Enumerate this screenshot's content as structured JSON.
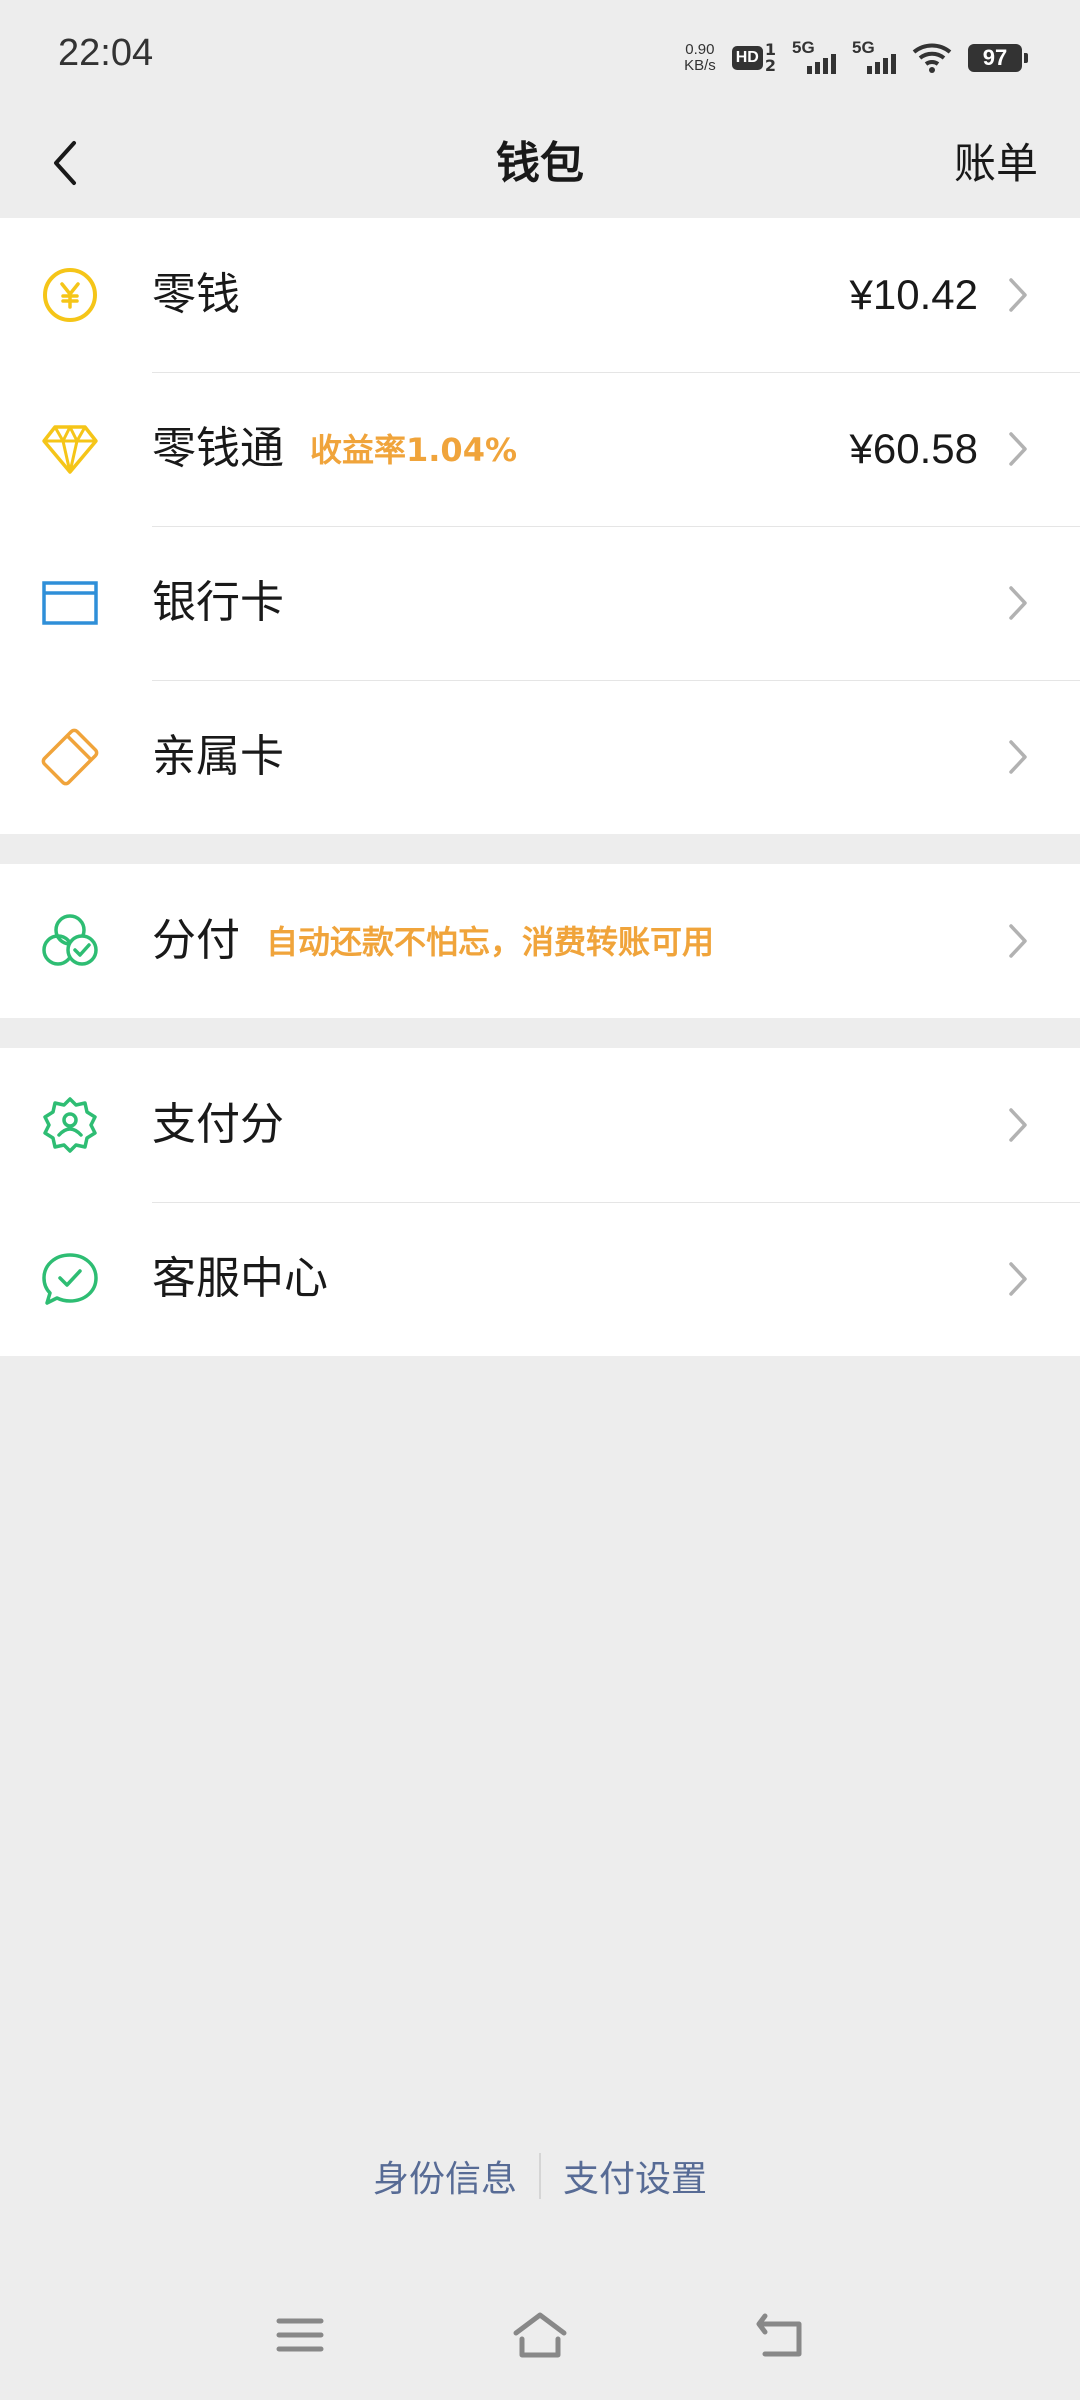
{
  "status_bar": {
    "time": "22:04",
    "net_speed_value": "0.90",
    "net_speed_unit": "KB/s",
    "hd_label": "HD",
    "hd_sim1": "1",
    "hd_sim2": "2",
    "sim1_network": "5G",
    "sim2_network": "5G",
    "battery": "97"
  },
  "nav": {
    "title": "钱包",
    "right_action": "账单"
  },
  "groups": [
    {
      "items": [
        {
          "label": "零钱",
          "tag": "",
          "amount": "¥10.42",
          "icon": "yuan-coin-icon",
          "color": "#f5c518"
        },
        {
          "label": "零钱通",
          "tag": "收益率1.04%",
          "amount": "¥60.58",
          "icon": "diamond-icon",
          "color": "#f5c518"
        },
        {
          "label": "银行卡",
          "tag": "",
          "amount": "",
          "icon": "bank-card-icon",
          "color": "#2f8fd8"
        },
        {
          "label": "亲属卡",
          "tag": "",
          "amount": "",
          "icon": "family-card-icon",
          "color": "#f0a43b"
        }
      ]
    },
    {
      "items": [
        {
          "label": "分付",
          "tag": "自动还款不怕忘，消费转账可用",
          "amount": "",
          "icon": "fenfu-icon",
          "color": "#2ebd73"
        }
      ]
    },
    {
      "items": [
        {
          "label": "支付分",
          "tag": "",
          "amount": "",
          "icon": "pay-score-badge-icon",
          "color": "#2ebd73"
        },
        {
          "label": "客服中心",
          "tag": "",
          "amount": "",
          "icon": "customer-service-chat-icon",
          "color": "#2ebd73"
        }
      ]
    }
  ],
  "footer": {
    "identity_link": "身份信息",
    "settings_link": "支付设置"
  },
  "colors": {
    "background": "#ededed",
    "link": "#576b95",
    "tag": "#f0a43b"
  }
}
